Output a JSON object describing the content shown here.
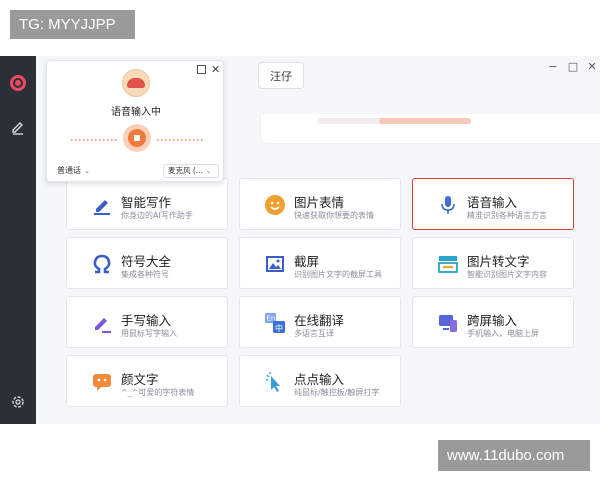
{
  "watermarks": {
    "tg": "TG: MYYJJPP",
    "site": "www.11dubo.com"
  },
  "window_controls": {
    "min": "−",
    "max": "□",
    "close": "✕"
  },
  "header": {
    "tag_button": "汪仔"
  },
  "popup": {
    "title": "语音输入中",
    "language": "普通话",
    "language_chevron": "⌄",
    "mic": "麦克风 (...",
    "mic_chevron": "⌄",
    "close": "✕"
  },
  "cards": [
    {
      "title": "智能写作",
      "sub": "你身边的AI写作助手",
      "icon": "pen-icon",
      "color": "#3b5ccc"
    },
    {
      "title": "图片表情",
      "sub": "快速获取你想要的表情",
      "icon": "smile-icon",
      "color": "#f0a030"
    },
    {
      "title": "语音输入",
      "sub": "精准识别各种语言方言",
      "icon": "microphone-icon",
      "color": "#3b6fd6",
      "selected": true
    },
    {
      "title": "符号大全",
      "sub": "集成各种符号",
      "icon": "omega-icon",
      "color": "#3b5ccc"
    },
    {
      "title": "截屏",
      "sub": "识别图片文字的截屏工具",
      "icon": "screenshot-icon",
      "color": "#3b5ccc"
    },
    {
      "title": "图片转文字",
      "sub": "智能识别图片文字内容",
      "icon": "image-text-icon",
      "color": "#2aa3c9"
    },
    {
      "title": "手写输入",
      "sub": "用鼠标写字输入",
      "icon": "handwrite-icon",
      "color": "#7a5be0"
    },
    {
      "title": "在线翻译",
      "sub": "多语言互译",
      "icon": "translate-icon",
      "color": "#3b6fd6"
    },
    {
      "title": "跨屏输入",
      "sub": "手机输入，电脑上屏",
      "icon": "cross-screen-icon",
      "color": "#5865d8"
    },
    {
      "title": "颜文字",
      "sub": "^_^可爱的字符表情",
      "icon": "emoticon-icon",
      "color": "#f08a3c"
    },
    {
      "title": "点点输入",
      "sub": "纯鼠标/触控板/触屏打字",
      "icon": "cursor-click-icon",
      "color": "#3b9fd6"
    }
  ],
  "colors": {
    "sidebar": "#2b2f38",
    "accent": "#ec4a60",
    "selected_border": "#d93b3b"
  }
}
